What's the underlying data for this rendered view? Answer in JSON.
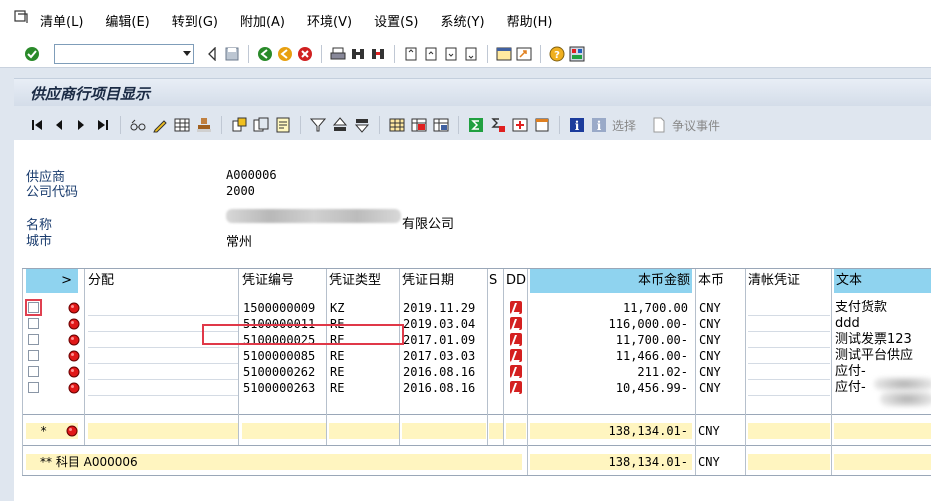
{
  "menu": {
    "items": [
      "清单(L)",
      "编辑(E)",
      "转到(G)",
      "附加(A)",
      "环境(V)",
      "设置(S)",
      "系统(Y)",
      "帮助(H)"
    ]
  },
  "toolbar": {
    "command_value": ""
  },
  "app_toolbar": {
    "choose_label": "选择",
    "dispute_label": "争议事件"
  },
  "title": "供应商行项目显示",
  "header": {
    "vendor_label": "供应商",
    "vendor_value": "A000006",
    "company_code_label": "公司代码",
    "company_code_value": "2000",
    "name_label": "名称",
    "name_value_visible": "有限公司",
    "city_label": "城市",
    "city_value": "常州"
  },
  "grid": {
    "columns": [
      ">",
      "分配",
      "凭证编号",
      "凭证类型",
      "凭证日期",
      "S",
      "DD",
      "本币金额",
      "本币",
      "清帐凭证",
      "文本"
    ],
    "rows": [
      {
        "doc_no": "1500000009",
        "doc_type": "KZ",
        "doc_date": "2019.11.29",
        "amount": "11,700.00",
        "currency": "CNY",
        "text": "支付货款"
      },
      {
        "doc_no": "5100000011",
        "doc_type": "RE",
        "doc_date": "2019.03.04",
        "amount": "116,000.00-",
        "currency": "CNY",
        "text": "ddd"
      },
      {
        "doc_no": "5100000025",
        "doc_type": "RE",
        "doc_date": "2017.01.09",
        "amount": "11,700.00-",
        "currency": "CNY",
        "text": "测试发票123"
      },
      {
        "doc_no": "5100000085",
        "doc_type": "RE",
        "doc_date": "2017.03.03",
        "amount": "11,466.00-",
        "currency": "CNY",
        "text": "测试平台供应"
      },
      {
        "doc_no": "5100000262",
        "doc_type": "RE",
        "doc_date": "2016.08.16",
        "amount": "211.02-",
        "currency": "CNY",
        "text": "应付-"
      },
      {
        "doc_no": "5100000263",
        "doc_type": "RE",
        "doc_date": "2016.08.16",
        "amount": "10,456.99-",
        "currency": "CNY",
        "text": "应付-"
      }
    ],
    "subtotal": {
      "marker": "*",
      "amount": "138,134.01-",
      "currency": "CNY"
    },
    "total": {
      "label": "** 科目 A000006",
      "amount": "138,134.01-",
      "currency": "CNY"
    }
  },
  "colors": {
    "header_highlight": "#8fd3ef",
    "subtotal_yellow": "#fff5c0",
    "row_blue": "#dfe8f2",
    "selection_red": "#e03848"
  }
}
